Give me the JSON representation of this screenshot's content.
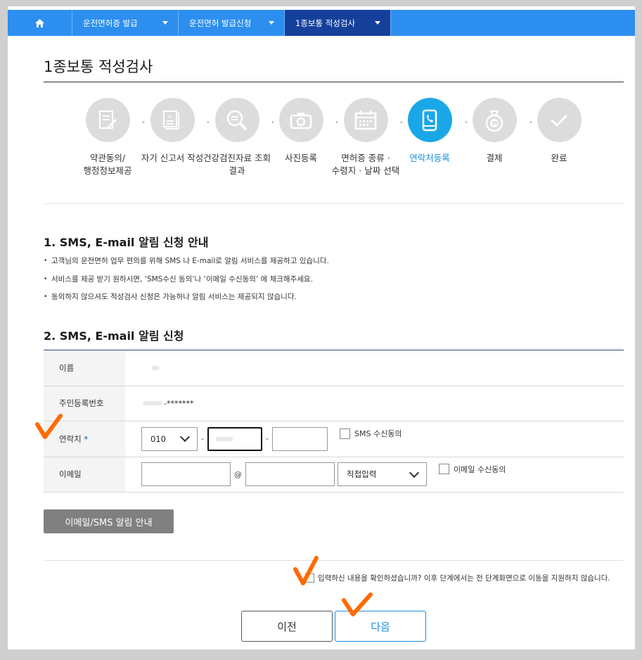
{
  "nav": {
    "items": [
      {
        "label": "운전면허증 발급"
      },
      {
        "label": "운전면허 발급신청"
      },
      {
        "label": "1종보통 적성검사"
      }
    ]
  },
  "page_title": "1종보통 적성검사",
  "steps": [
    {
      "line1": "약관동의/",
      "line2": "행정정보제공",
      "icon": "document-pen-icon"
    },
    {
      "line1": "자기 신고서 작성",
      "line2": "",
      "icon": "id-card-icon"
    },
    {
      "line1": "건강검진자료 조회",
      "line2": "결과",
      "icon": "magnifier-doc-icon"
    },
    {
      "line1": "사진등록",
      "line2": "",
      "icon": "camera-icon"
    },
    {
      "line1": "면허증 종류 ·",
      "line2": "수령지 · 날짜 선택",
      "icon": "calendar-icon"
    },
    {
      "line1": "연락처등록",
      "line2": "",
      "icon": "phone-icon"
    },
    {
      "line1": "결제",
      "line2": "",
      "icon": "money-bag-icon"
    },
    {
      "line1": "완료",
      "line2": "",
      "icon": "check-icon"
    }
  ],
  "section1": {
    "title": "1. SMS, E-mail 알림 신청 안내",
    "bullets": [
      "고객님의 운전면허 업무 편의를 위해 SMS 나 E-mail로 알림 서비스를 제공하고 있습니다.",
      "서비스를 제공 받기 원하시면, ‘SMS수신 동의’나 ‘이메일 수신동의’ 에 체크해주세요.",
      "동의하지 않으셔도 적성검사 신청은 가능하나 알림 서비스는 제공되지 않습니다."
    ]
  },
  "section2": {
    "title": "2. SMS, E-mail 알림 신청"
  },
  "form": {
    "name_label": "이름",
    "rrn_label": "주민등록번호",
    "rrn_value": "-*******",
    "phone_label": "연락치",
    "required_mark": "*",
    "phone_prefix": "010",
    "phone_dash": "-",
    "sms_label": "SMS 수신동의",
    "email_label": "이메일",
    "email_at": "@",
    "email_domain_select": "직접입력",
    "email_consent_label": "이메일 수신동의"
  },
  "info_button": "이메일/SMS 알림 안내",
  "confirm_text": "입력하신 내용을 확인하셨습니까? 이후 단계에서는 전 단계화면으로 이동을 지원하지 않습니다.",
  "buttons": {
    "prev": "이전",
    "next": "다음"
  },
  "colors": {
    "nav_bg": "#2c8ff0",
    "nav_active": "#14409c",
    "step_active": "#1aa7e8",
    "annotation": "#ff6a00"
  }
}
